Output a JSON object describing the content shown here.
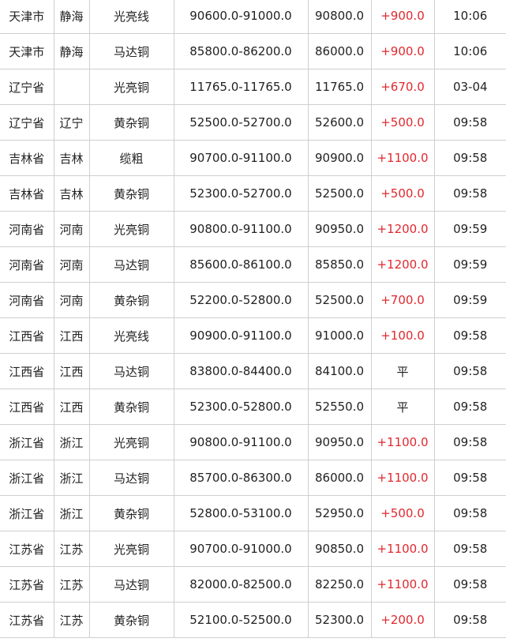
{
  "colors": {
    "up": "#e0282e",
    "text": "#222222",
    "border": "#cfcfcf"
  },
  "rows": [
    {
      "province": "天津市",
      "city": "静海",
      "product": "光亮线",
      "range": "90600.0-91000.0",
      "avg": "90800.0",
      "change": "+900.0",
      "time": "10:06",
      "trend": "up"
    },
    {
      "province": "天津市",
      "city": "静海",
      "product": "马达铜",
      "range": "85800.0-86200.0",
      "avg": "86000.0",
      "change": "+900.0",
      "time": "10:06",
      "trend": "up"
    },
    {
      "province": "辽宁省",
      "city": "",
      "product": "光亮铜",
      "range": "11765.0-11765.0",
      "avg": "11765.0",
      "change": "+670.0",
      "time": "03-04",
      "trend": "up"
    },
    {
      "province": "辽宁省",
      "city": "辽宁",
      "product": "黄杂铜",
      "range": "52500.0-52700.0",
      "avg": "52600.0",
      "change": "+500.0",
      "time": "09:58",
      "trend": "up"
    },
    {
      "province": "吉林省",
      "city": "吉林",
      "product": "缆粗",
      "range": "90700.0-91100.0",
      "avg": "90900.0",
      "change": "+1100.0",
      "time": "09:58",
      "trend": "up"
    },
    {
      "province": "吉林省",
      "city": "吉林",
      "product": "黄杂铜",
      "range": "52300.0-52700.0",
      "avg": "52500.0",
      "change": "+500.0",
      "time": "09:58",
      "trend": "up"
    },
    {
      "province": "河南省",
      "city": "河南",
      "product": "光亮铜",
      "range": "90800.0-91100.0",
      "avg": "90950.0",
      "change": "+1200.0",
      "time": "09:59",
      "trend": "up"
    },
    {
      "province": "河南省",
      "city": "河南",
      "product": "马达铜",
      "range": "85600.0-86100.0",
      "avg": "85850.0",
      "change": "+1200.0",
      "time": "09:59",
      "trend": "up"
    },
    {
      "province": "河南省",
      "city": "河南",
      "product": "黄杂铜",
      "range": "52200.0-52800.0",
      "avg": "52500.0",
      "change": "+700.0",
      "time": "09:59",
      "trend": "up"
    },
    {
      "province": "江西省",
      "city": "江西",
      "product": "光亮线",
      "range": "90900.0-91100.0",
      "avg": "91000.0",
      "change": "+100.0",
      "time": "09:58",
      "trend": "up"
    },
    {
      "province": "江西省",
      "city": "江西",
      "product": "马达铜",
      "range": "83800.0-84400.0",
      "avg": "84100.0",
      "change": "平",
      "time": "09:58",
      "trend": "flat"
    },
    {
      "province": "江西省",
      "city": "江西",
      "product": "黄杂铜",
      "range": "52300.0-52800.0",
      "avg": "52550.0",
      "change": "平",
      "time": "09:58",
      "trend": "flat"
    },
    {
      "province": "浙江省",
      "city": "浙江",
      "product": "光亮铜",
      "range": "90800.0-91100.0",
      "avg": "90950.0",
      "change": "+1100.0",
      "time": "09:58",
      "trend": "up"
    },
    {
      "province": "浙江省",
      "city": "浙江",
      "product": "马达铜",
      "range": "85700.0-86300.0",
      "avg": "86000.0",
      "change": "+1100.0",
      "time": "09:58",
      "trend": "up"
    },
    {
      "province": "浙江省",
      "city": "浙江",
      "product": "黄杂铜",
      "range": "52800.0-53100.0",
      "avg": "52950.0",
      "change": "+500.0",
      "time": "09:58",
      "trend": "up"
    },
    {
      "province": "江苏省",
      "city": "江苏",
      "product": "光亮铜",
      "range": "90700.0-91000.0",
      "avg": "90850.0",
      "change": "+1100.0",
      "time": "09:58",
      "trend": "up"
    },
    {
      "province": "江苏省",
      "city": "江苏",
      "product": "马达铜",
      "range": "82000.0-82500.0",
      "avg": "82250.0",
      "change": "+1100.0",
      "time": "09:58",
      "trend": "up"
    },
    {
      "province": "江苏省",
      "city": "江苏",
      "product": "黄杂铜",
      "range": "52100.0-52500.0",
      "avg": "52300.0",
      "change": "+200.0",
      "time": "09:58",
      "trend": "up"
    }
  ]
}
